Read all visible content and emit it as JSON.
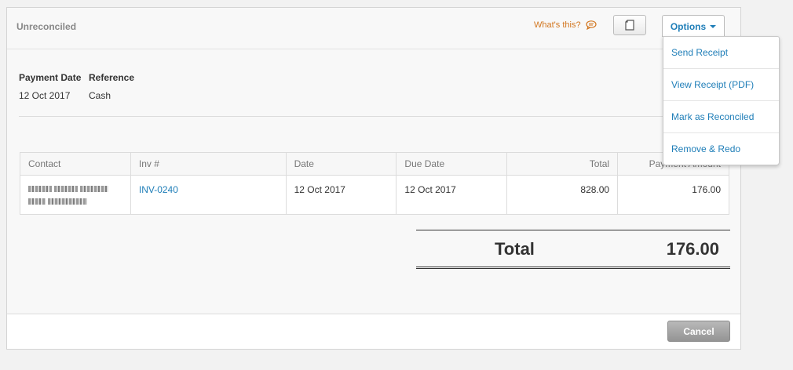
{
  "header": {
    "status": "Unreconciled",
    "whats_this": "What's this?",
    "options_label": "Options"
  },
  "options_menu": {
    "items": [
      {
        "label": "Send Receipt"
      },
      {
        "label": "View Receipt (PDF)"
      },
      {
        "label": "Mark as Reconciled"
      },
      {
        "label": "Remove & Redo"
      }
    ]
  },
  "payment": {
    "date_label": "Payment Date",
    "reference_label": "Reference",
    "date_value": "12 Oct 2017",
    "reference_value": "Cash"
  },
  "table": {
    "columns": [
      "Contact",
      "Inv #",
      "Date",
      "Due Date",
      "Total",
      "Payment Amount"
    ],
    "rows": [
      {
        "contact": "",
        "invoice": "INV-0240",
        "date": "12 Oct 2017",
        "due_date": "12 Oct 2017",
        "total": "828.00",
        "payment_amount": "176.00"
      }
    ]
  },
  "summary": {
    "total_label": "Total",
    "total_value": "176.00"
  },
  "footer": {
    "cancel_label": "Cancel"
  },
  "colors": {
    "link": "#1f7eb8",
    "help": "#d2761f",
    "cancel_bg": "#a3a3a3"
  }
}
